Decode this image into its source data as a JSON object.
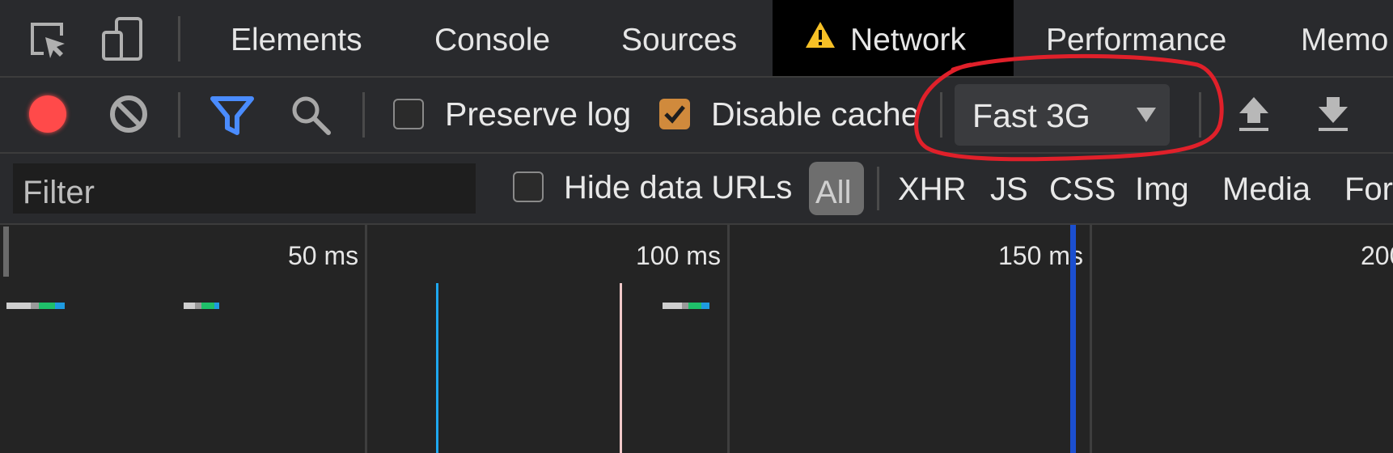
{
  "tabs": [
    {
      "label": "Elements"
    },
    {
      "label": "Console"
    },
    {
      "label": "Sources"
    },
    {
      "label": "Network",
      "warning": "warning-icon"
    },
    {
      "label": "Performance"
    },
    {
      "label": "Memo"
    }
  ],
  "toolbar": {
    "preserve_log_label": "Preserve log",
    "preserve_log_checked": false,
    "disable_cache_label": "Disable cache",
    "disable_cache_checked": true,
    "throttling_value": "Fast 3G",
    "record_color": "#ff4a4a",
    "filter_icon_color": "#4a8cff"
  },
  "filterbar": {
    "filter_placeholder": "Filter",
    "hide_data_urls_label": "Hide data URLs",
    "hide_data_urls_checked": false,
    "types": [
      "All",
      "XHR",
      "JS",
      "CSS",
      "Img",
      "Media",
      "For"
    ]
  },
  "timeline": {
    "ticks": [
      "50 ms",
      "100 ms",
      "150 ms",
      "200"
    ]
  },
  "annotation": {
    "color": "#e0202a"
  }
}
